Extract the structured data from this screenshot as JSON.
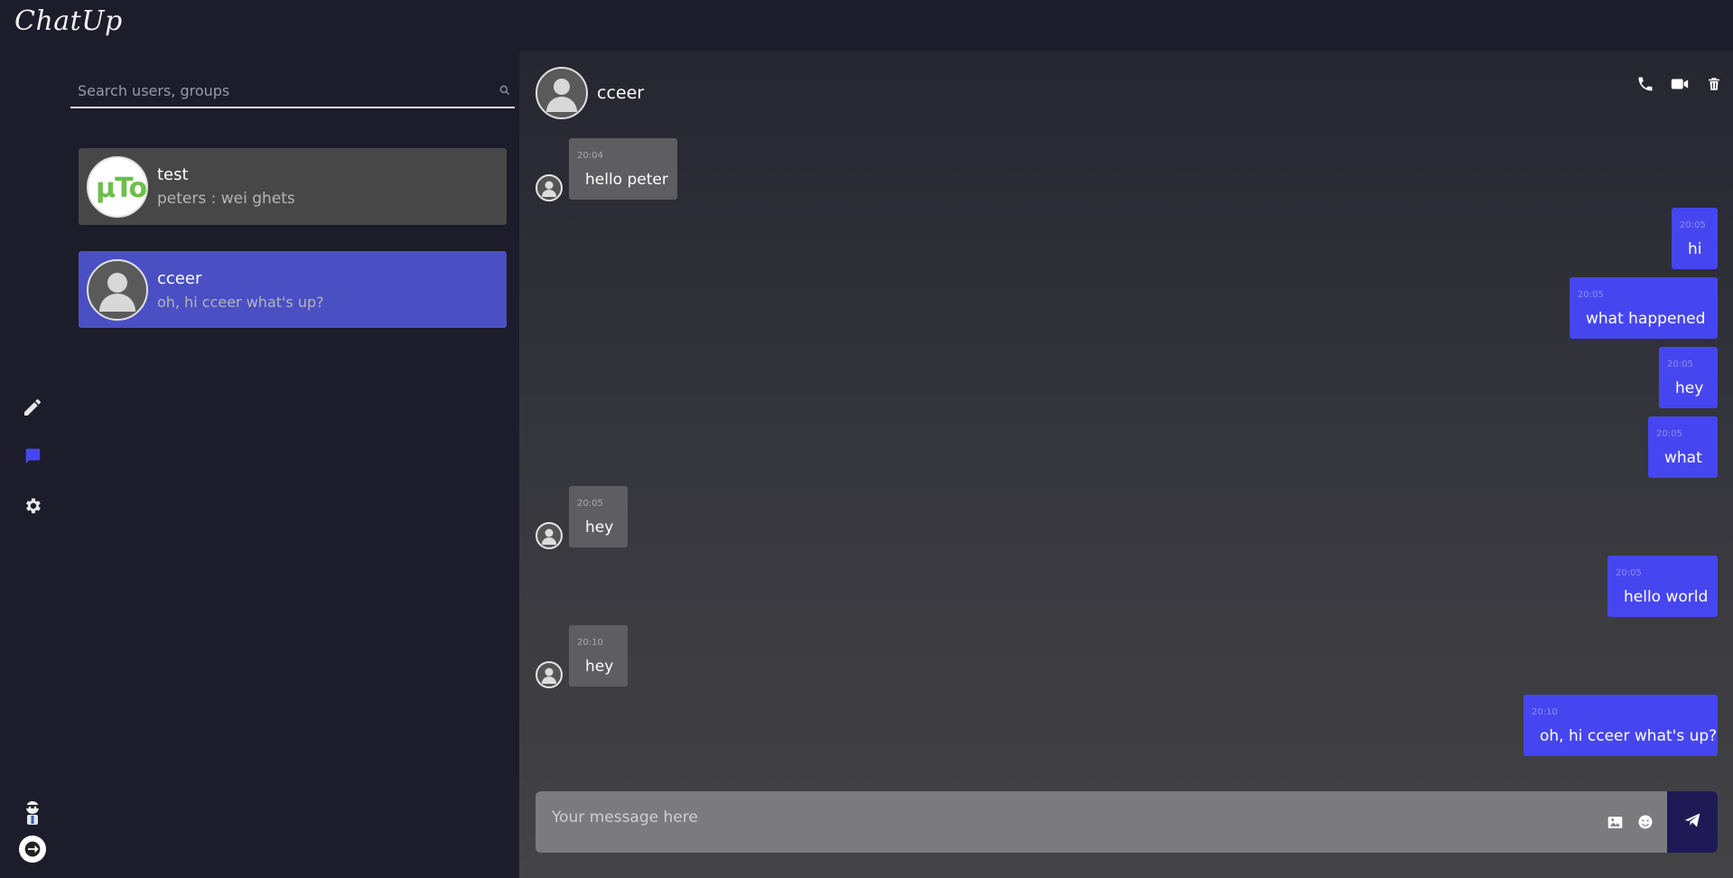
{
  "app": {
    "logo": "ChatUp"
  },
  "sidebar": {
    "icons": [
      "edit-icon",
      "chat-icon",
      "settings-icon",
      "profile-avatar",
      "logout-icon"
    ]
  },
  "search": {
    "placeholder": "Search users, groups"
  },
  "conversations": [
    {
      "name": "test",
      "preview": "peters : wei ghets",
      "avatar_text": "µTor",
      "active": false
    },
    {
      "name": "cceer",
      "preview": "oh, hi cceer what's up?",
      "active": true
    }
  ],
  "chat": {
    "contact_name": "cceer",
    "messages": [
      {
        "dir": "in",
        "time": "20:04",
        "text": "hello peter"
      },
      {
        "dir": "out",
        "time": "20:05",
        "text": "hi"
      },
      {
        "dir": "out",
        "time": "20:05",
        "text": "what happened"
      },
      {
        "dir": "out",
        "time": "20:05",
        "text": "hey"
      },
      {
        "dir": "out",
        "time": "20:05",
        "text": "what"
      },
      {
        "dir": "in",
        "time": "20:05",
        "text": "hey"
      },
      {
        "dir": "out",
        "time": "20:05",
        "text": "hello world"
      },
      {
        "dir": "in",
        "time": "20:10",
        "text": "hey"
      },
      {
        "dir": "out",
        "time": "20:10",
        "text": "oh, hi cceer what's up?"
      }
    ],
    "composer_placeholder": "Your message here"
  },
  "colors": {
    "accent": "#4646f0",
    "active_conv": "#4a4fc4",
    "inactive_conv": "#474747",
    "send_button": "#1f1a55"
  }
}
